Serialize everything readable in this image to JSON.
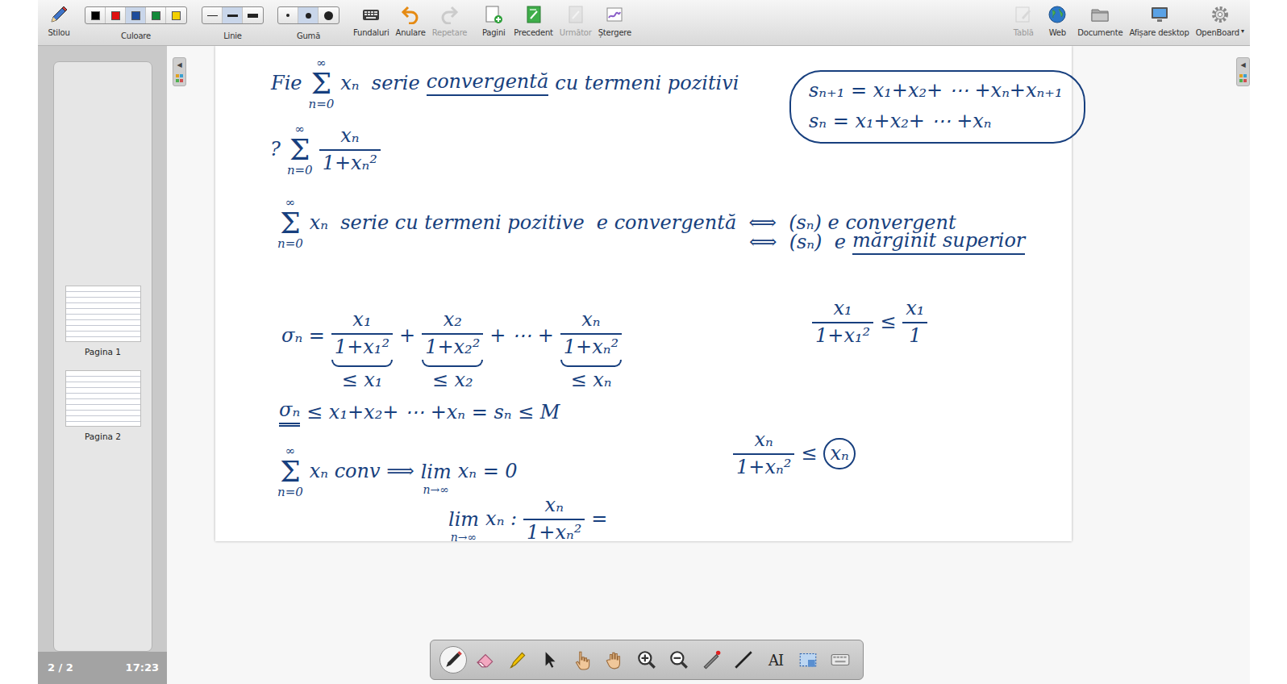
{
  "toolbar": {
    "pen": {
      "label": "Stilou"
    },
    "colors": {
      "label": "Culoare",
      "swatches": [
        {
          "color": "#000000",
          "selected": false
        },
        {
          "color": "#e01010",
          "selected": false
        },
        {
          "color": "#1d4c9c",
          "selected": true
        },
        {
          "color": "#138a3a",
          "selected": false
        },
        {
          "color": "#f3d000",
          "selected": false
        }
      ]
    },
    "lines": {
      "label": "Linie",
      "options": [
        {
          "selected": false
        },
        {
          "selected": true
        },
        {
          "selected": false
        }
      ]
    },
    "erasers": {
      "label": "Gumă",
      "options": [
        {
          "selected": false
        },
        {
          "selected": true
        },
        {
          "selected": false
        }
      ]
    },
    "actions": [
      {
        "label": "Fundaluri",
        "disabled": false
      },
      {
        "label": "Anulare",
        "disabled": false
      },
      {
        "label": "Repetare",
        "disabled": true
      },
      {
        "label": "Pagini",
        "disabled": false
      },
      {
        "label": "Precedent",
        "disabled": false
      },
      {
        "label": "Următor",
        "disabled": true
      },
      {
        "label": "Ștergere",
        "disabled": false
      }
    ],
    "right_actions": [
      {
        "label": "Tablă",
        "disabled": true
      },
      {
        "label": "Web",
        "disabled": false
      },
      {
        "label": "Documente",
        "disabled": false
      },
      {
        "label": "Afișare desktop",
        "disabled": false
      },
      {
        "label": "OpenBoard",
        "disabled": false
      }
    ],
    "menu_arrow": "▾"
  },
  "pages_panel": {
    "thumbnails": [
      {
        "label": "Pagina 1"
      },
      {
        "label": "Pagina 2"
      }
    ],
    "counter": "2 / 2",
    "clock": "17:23",
    "collapse": "◀"
  },
  "right_tab": {
    "collapse": "◀"
  },
  "board": {
    "items": [
      {
        "kind": "plain",
        "lines": [
          {
            "segments": [
              {
                "kind": "text",
                "text": "Fie"
              },
              {
                "kind": "sum",
                "over": "∞",
                "sign": "Σ",
                "under": "n=0"
              },
              {
                "kind": "text",
                "text": "xₙ  serie"
              },
              {
                "kind": "underlined",
                "text": "convergentă"
              },
              {
                "kind": "text",
                "text": "cu termeni pozitivi"
              }
            ]
          }
        ]
      },
      {
        "kind": "plain",
        "lines": [
          {
            "segments": [
              {
                "kind": "text",
                "text": "?"
              },
              {
                "kind": "sum",
                "over": "∞",
                "sign": "Σ",
                "under": "n=0"
              },
              {
                "kind": "frac",
                "num": "xₙ",
                "den": "1+xₙ²"
              }
            ]
          }
        ]
      },
      {
        "kind": "boxed",
        "lines": [
          {
            "segments": [
              {
                "kind": "text",
                "text": "sₙ₊₁ = x₁+x₂+ ⋯ +xₙ+xₙ₊₁"
              }
            ]
          },
          {
            "segments": [
              {
                "kind": "text",
                "text": "sₙ = x₁+x₂+ ⋯ +xₙ"
              }
            ]
          }
        ]
      },
      {
        "kind": "plain",
        "lines": [
          {
            "segments": [
              {
                "kind": "sum",
                "over": "∞",
                "sign": "Σ",
                "under": "n=0"
              },
              {
                "kind": "text",
                "text": "xₙ  serie cu termeni pozitive  e convergentă  ⟺  (sₙ) e convergent"
              }
            ]
          }
        ]
      },
      {
        "kind": "plain",
        "lines": [
          {
            "segments": [
              {
                "kind": "text",
                "text": "⟺  (sₙ)  e"
              },
              {
                "kind": "underlined",
                "text": "mărginit superior"
              }
            ]
          }
        ]
      },
      {
        "kind": "plain",
        "lines": [
          {
            "segments": [
              {
                "kind": "text",
                "text": "σₙ ="
              },
              {
                "kind": "frac-brace",
                "num": "x₁",
                "den": "1+x₁²",
                "note": "≤ x₁"
              },
              {
                "kind": "text",
                "text": "+"
              },
              {
                "kind": "frac-brace",
                "num": "x₂",
                "den": "1+x₂²",
                "note": "≤ x₂"
              },
              {
                "kind": "text",
                "text": "+ ⋯ +"
              },
              {
                "kind": "frac-brace",
                "num": "xₙ",
                "den": "1+xₙ²",
                "note": "≤ xₙ"
              }
            ]
          }
        ]
      },
      {
        "kind": "plain",
        "lines": [
          {
            "segments": [
              {
                "kind": "frac",
                "num": "x₁",
                "den": "1+x₁²"
              },
              {
                "kind": "text",
                "text": "≤"
              },
              {
                "kind": "frac",
                "num": "x₁",
                "den": "1"
              }
            ]
          }
        ]
      },
      {
        "kind": "plain",
        "lines": [
          {
            "segments": [
              {
                "kind": "double-underlined",
                "text": "σₙ"
              },
              {
                "kind": "text",
                "text": "≤ x₁+x₂+ ⋯ +xₙ = sₙ ≤ M"
              }
            ]
          }
        ]
      },
      {
        "kind": "plain",
        "lines": [
          {
            "segments": [
              {
                "kind": "frac",
                "num": "xₙ",
                "den": "1+xₙ²"
              },
              {
                "kind": "text",
                "text": "≤"
              },
              {
                "kind": "circled",
                "text": "xₙ"
              }
            ]
          }
        ]
      },
      {
        "kind": "plain",
        "lines": [
          {
            "segments": [
              {
                "kind": "sum",
                "over": "∞",
                "sign": "Σ",
                "under": "n=0"
              },
              {
                "kind": "text",
                "text": "xₙ conv ⟹"
              },
              {
                "kind": "lim",
                "word": "lim",
                "under": "n→∞"
              },
              {
                "kind": "text",
                "text": "xₙ = 0"
              }
            ]
          }
        ]
      },
      {
        "kind": "plain",
        "lines": [
          {
            "segments": [
              {
                "kind": "lim",
                "word": "lim",
                "under": "n→∞"
              },
              {
                "kind": "text",
                "text": "xₙ :"
              },
              {
                "kind": "frac",
                "num": "xₙ",
                "den": "1+xₙ²"
              },
              {
                "kind": "text",
                "text": "="
              }
            ]
          }
        ]
      }
    ]
  },
  "floating_toolbar": {
    "tools": [
      {
        "kind": "pen",
        "selected": true
      },
      {
        "kind": "eraser",
        "selected": false
      },
      {
        "kind": "marker",
        "selected": false
      },
      {
        "kind": "pointer",
        "selected": false
      },
      {
        "kind": "hand-pointer",
        "selected": false
      },
      {
        "kind": "hand",
        "selected": false
      },
      {
        "kind": "zoom-in",
        "selected": false
      },
      {
        "kind": "zoom-out",
        "selected": false
      },
      {
        "kind": "laser",
        "selected": false
      },
      {
        "kind": "line",
        "selected": false
      },
      {
        "kind": "text",
        "label": "AI",
        "selected": false
      },
      {
        "kind": "capture",
        "selected": false
      },
      {
        "kind": "keyboard",
        "selected": false
      }
    ]
  }
}
